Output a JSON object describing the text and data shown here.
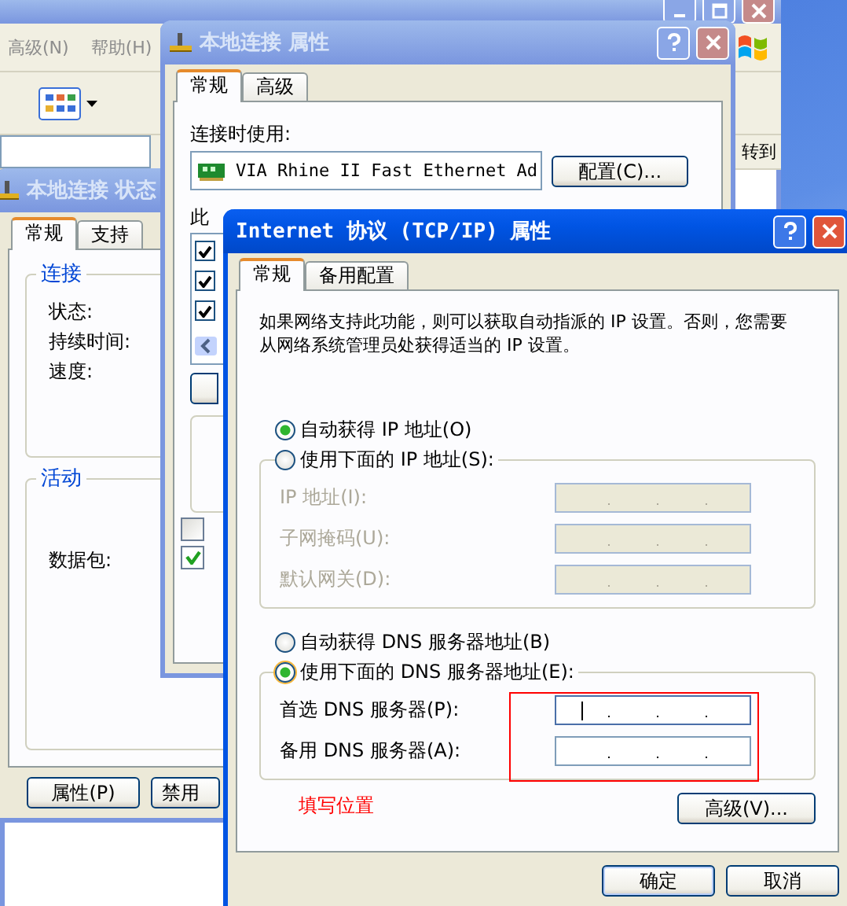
{
  "explorer": {
    "menu": [
      "高级(N)",
      "帮助(H)"
    ],
    "go_button": "转到"
  },
  "status_window": {
    "title": "本地连接 状态",
    "tabs": [
      {
        "label": "常规",
        "selected": true
      },
      {
        "label": "支持",
        "selected": false
      }
    ],
    "groups": [
      {
        "title": "连接",
        "labels": [
          "状态:",
          "持续时间:",
          "速度:"
        ]
      },
      {
        "title": "活动",
        "labels": [
          "数据包:"
        ]
      }
    ],
    "buttons": [
      "属性(P)",
      "禁用"
    ]
  },
  "properties_window": {
    "title": "本地连接 属性",
    "tabs": [
      {
        "label": "常规",
        "selected": true
      },
      {
        "label": "高级",
        "selected": false
      }
    ],
    "connect_label": "连接时使用:",
    "adapter": "VIA Rhine II Fast Ethernet Ad",
    "configure_button": "配置(C)...",
    "list_label": "此",
    "components": [
      {
        "checked": true
      },
      {
        "checked": true
      },
      {
        "checked": true
      }
    ],
    "options": [
      {
        "checked": false
      },
      {
        "checked": true
      }
    ]
  },
  "tcpip_window": {
    "title": "Internet 协议 (TCP/IP) 属性",
    "tabs": [
      {
        "label": "常规",
        "selected": true
      },
      {
        "label": "备用配置",
        "selected": false
      }
    ],
    "description": "如果网络支持此功能，则可以获取自动指派的 IP 设置。否则，您需要从网络系统管理员处获得适当的 IP 设置。",
    "ip_mode": [
      {
        "label": "自动获得 IP 地址(O)",
        "selected": true
      },
      {
        "label": "使用下面的 IP 地址(S):",
        "selected": false
      }
    ],
    "ip_fields": [
      {
        "label": "IP 地址(I):",
        "disabled": true
      },
      {
        "label": "子网掩码(U):",
        "disabled": true
      },
      {
        "label": "默认网关(D):",
        "disabled": true
      }
    ],
    "dns_mode": [
      {
        "label": "自动获得 DNS 服务器地址(B)",
        "selected": false
      },
      {
        "label": "使用下面的 DNS 服务器地址(E):",
        "selected": true
      }
    ],
    "dns_fields": [
      {
        "label": "首选 DNS 服务器(P):",
        "disabled": false,
        "focused": true
      },
      {
        "label": "备用 DNS 服务器(A):",
        "disabled": false,
        "focused": false
      }
    ],
    "annotation": "填写位置",
    "advanced_button": "高级(V)...",
    "buttons": [
      "确定",
      "取消"
    ]
  }
}
